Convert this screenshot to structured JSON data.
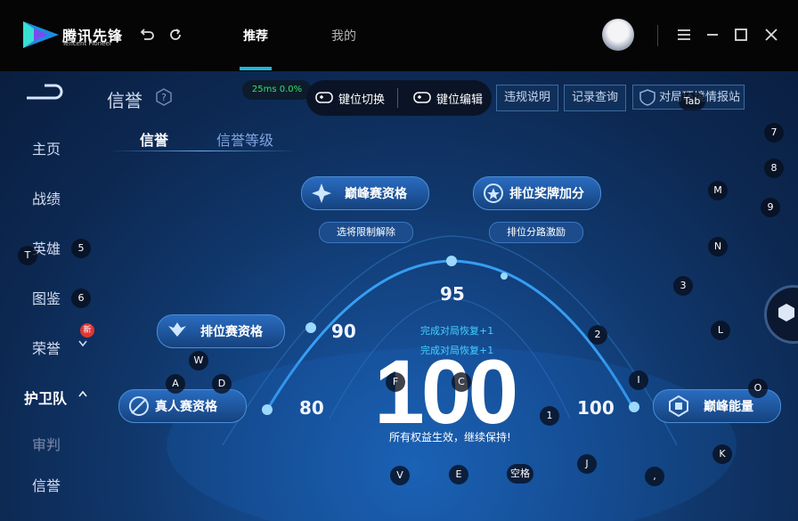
{
  "app": {
    "logo_text": "腾讯先锋",
    "logo_sub": "Tencent Pioneer"
  },
  "topnav": {
    "tabs": [
      {
        "label": "推荐",
        "active": true
      },
      {
        "label": "我的",
        "active": false
      }
    ]
  },
  "header": {
    "title": "信誉",
    "ping": "25ms  0.0%",
    "key_switch": "键位切换",
    "key_edit": "键位编辑",
    "violation": "违规说明",
    "records": "记录查询",
    "report": "对局环境情报站"
  },
  "sidebar": {
    "items": [
      {
        "label": "主页"
      },
      {
        "label": "战绩"
      },
      {
        "label": "英雄"
      },
      {
        "label": "图鉴"
      },
      {
        "label": "荣誉",
        "badge": "新"
      },
      {
        "label": "护卫队",
        "active": true
      },
      {
        "label": "审判",
        "dim": true
      },
      {
        "label": "信誉"
      }
    ]
  },
  "subtabs": [
    {
      "label": "信誉",
      "active": true
    },
    {
      "label": "信誉等级",
      "active": false
    }
  ],
  "credit": {
    "score": "100",
    "caption": "所有权益生效，继续保持!",
    "note1": "完成对局恢复+1",
    "note2": "完成对局恢复+1",
    "scale": [
      "80",
      "90",
      "95",
      "100"
    ],
    "buttons": {
      "peak_qual": "巅峰赛资格",
      "rank_medal": "排位奖牌加分",
      "rank_qual": "排位赛资格",
      "real_qual": "真人赛资格",
      "peak_energy": "巅峰能量"
    },
    "sub_buttons": {
      "lift_limit": "选将限制解除",
      "rank_boost": "排位分路激励"
    }
  },
  "keys": {
    "tab": "Tab",
    "k7": "7",
    "k8": "8",
    "k9": "9",
    "M": "M",
    "N": "N",
    "k3": "3",
    "L": "L",
    "k2": "2",
    "I": "I",
    "O": "O",
    "K": "K",
    "J": "J",
    "comma": ",",
    "k1": "1",
    "space": "空格",
    "E": "E",
    "V": "V",
    "C": "C",
    "F": "F",
    "D": "D",
    "A": "A",
    "W": "W",
    "T": "T",
    "k5": "5",
    "k6": "6"
  },
  "colors": {
    "accent": "#1fb6d8",
    "ping_green": "#36e06a",
    "note_blue": "#43d0ff",
    "badge_red": "#e03636"
  }
}
